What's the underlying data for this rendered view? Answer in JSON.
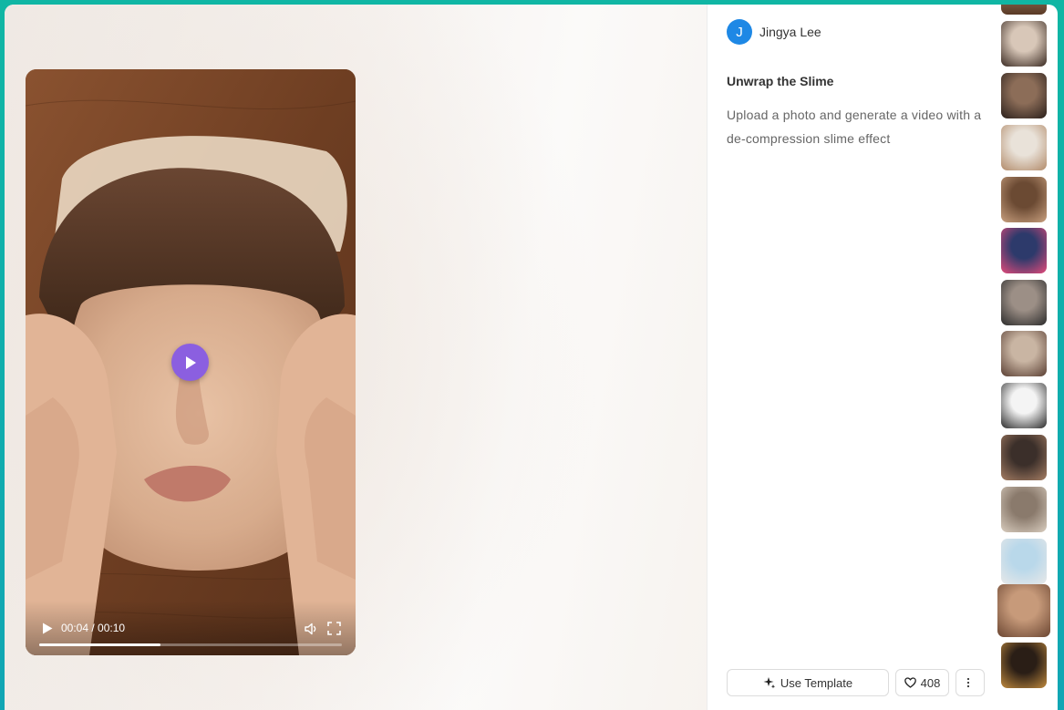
{
  "video": {
    "current_time": "00:04",
    "duration": "00:10",
    "time_separator": " / ",
    "progress": 0.4
  },
  "author": {
    "initial": "J",
    "name": "Jingya Lee"
  },
  "template": {
    "title": "Unwrap the Slime",
    "description": "Upload a photo and generate a video with a de-compression slime effect"
  },
  "actions": {
    "use_template": "Use Template",
    "likes": "408"
  },
  "thumbnails": [
    {
      "name": "thumb-1",
      "colors": [
        "#d8c7b8",
        "#3a2a22"
      ]
    },
    {
      "name": "thumb-2",
      "colors": [
        "#8c6d58",
        "#2a1f1b"
      ]
    },
    {
      "name": "thumb-3",
      "colors": [
        "#e9e2d9",
        "#b28b6a"
      ]
    },
    {
      "name": "thumb-4",
      "colors": [
        "#6b4a33",
        "#c9a07f"
      ]
    },
    {
      "name": "thumb-5",
      "colors": [
        "#2d3a6b",
        "#e34a7a"
      ]
    },
    {
      "name": "thumb-6",
      "colors": [
        "#9c8f86",
        "#2b2b2b"
      ]
    },
    {
      "name": "thumb-7",
      "colors": [
        "#c9b5a3",
        "#5a3f33"
      ]
    },
    {
      "name": "thumb-8",
      "colors": [
        "#f4f4f4",
        "#2b2b2b"
      ]
    },
    {
      "name": "thumb-9",
      "colors": [
        "#3b2f2a",
        "#a67e64"
      ]
    },
    {
      "name": "thumb-10",
      "colors": [
        "#8a7a6c",
        "#d9cdbf"
      ]
    },
    {
      "name": "thumb-11",
      "colors": [
        "#b9d8ea",
        "#e8e8e8"
      ]
    },
    {
      "name": "thumb-12",
      "colors": [
        "#c79a7a",
        "#6b4632"
      ]
    },
    {
      "name": "thumb-13",
      "colors": [
        "#2a1e16",
        "#c08a3e"
      ]
    }
  ],
  "colors": {
    "accent": "#8b5fe0",
    "avatar": "#1e88e5",
    "frame": "#10b6a4"
  },
  "icons": [
    "play-icon",
    "volume-icon",
    "fullscreen-icon",
    "sparkle-icon",
    "heart-icon",
    "more-icon"
  ]
}
